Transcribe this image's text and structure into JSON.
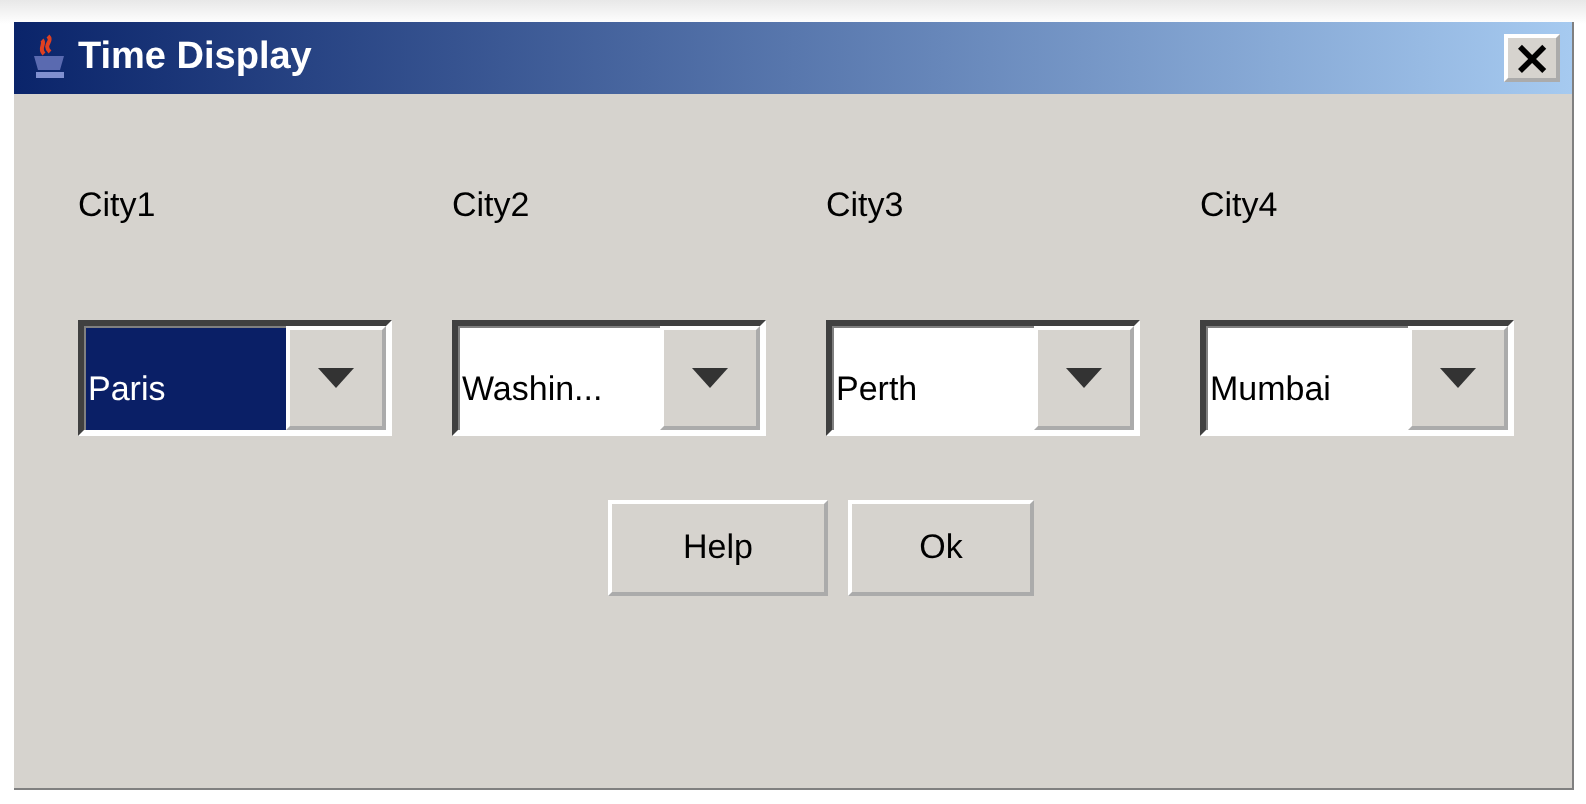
{
  "window": {
    "title": "Time Display",
    "close_button": "×"
  },
  "cities": [
    {
      "label": "City1",
      "value": "Paris",
      "focused": true
    },
    {
      "label": "City2",
      "value": "Washin...",
      "focused": false
    },
    {
      "label": "City3",
      "value": "Perth",
      "focused": false
    },
    {
      "label": "City4",
      "value": "Mumbai",
      "focused": false
    }
  ],
  "buttons": [
    "Help",
    "Ok"
  ]
}
